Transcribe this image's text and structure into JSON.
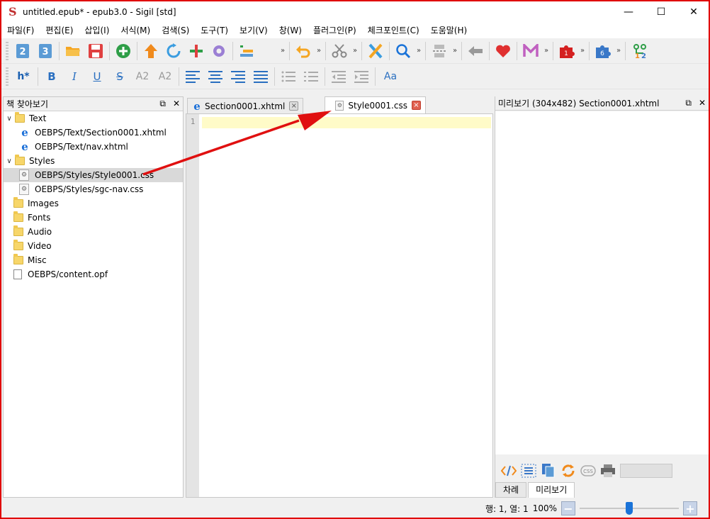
{
  "window": {
    "app_icon_glyph": "S",
    "title": "untitled.epub* - epub3.0 - Sigil [std]",
    "minimize": "—",
    "maximize": "☐",
    "close": "✕"
  },
  "menu": [
    "파일(F)",
    "편집(E)",
    "삽입(I)",
    "서식(M)",
    "검색(S)",
    "도구(T)",
    "보기(V)",
    "창(W)",
    "플러그인(P)",
    "체크포인트(C)",
    "도움말(H)"
  ],
  "toolbar": {
    "heading_label": "h*",
    "bold": "B",
    "italic": "I",
    "underline": "U",
    "strike": "S",
    "subscript": "A2",
    "superscript": "A2",
    "font_label": "Aa",
    "plugin1_badge": "1",
    "plugin6_badge": "6",
    "chevron": "»"
  },
  "left_dock": {
    "title": "책 찾아보기",
    "float_icon": "⧉",
    "close_icon": "✕",
    "tree": [
      {
        "label": "Text",
        "type": "folder",
        "expanded": true
      },
      {
        "label": "OEBPS/Text/Section0001.xhtml",
        "type": "xhtml"
      },
      {
        "label": "OEBPS/Text/nav.xhtml",
        "type": "xhtml"
      },
      {
        "label": "Styles",
        "type": "folder",
        "expanded": true
      },
      {
        "label": "OEBPS/Styles/Style0001.css",
        "type": "css",
        "selected": true
      },
      {
        "label": "OEBPS/Styles/sgc-nav.css",
        "type": "css"
      },
      {
        "label": "Images",
        "type": "folder"
      },
      {
        "label": "Fonts",
        "type": "folder"
      },
      {
        "label": "Audio",
        "type": "folder"
      },
      {
        "label": "Video",
        "type": "folder"
      },
      {
        "label": "Misc",
        "type": "folder"
      },
      {
        "label": "OEBPS/content.opf",
        "type": "file"
      }
    ]
  },
  "editor": {
    "tabs": [
      {
        "label": "Section0001.xhtml",
        "active": false
      },
      {
        "label": "Style0001.css",
        "active": true
      }
    ],
    "close_glyph": "×",
    "line_numbers": [
      "1"
    ]
  },
  "right_dock": {
    "title": "미리보기 (304x482) Section0001.xhtml",
    "float_icon": "⧉",
    "close_icon": "✕",
    "bottom_tabs": [
      {
        "label": "차례",
        "active": false
      },
      {
        "label": "미리보기",
        "active": true
      }
    ]
  },
  "status": {
    "position": "행: 1, 열: 1",
    "zoom": "100%",
    "zoom_out": "−",
    "zoom_in": "+",
    "zoom_level": 0.5
  },
  "colors": {
    "frame": "#e00000",
    "annotation_arrow": "#e01010",
    "accent": "#1a73d8"
  }
}
